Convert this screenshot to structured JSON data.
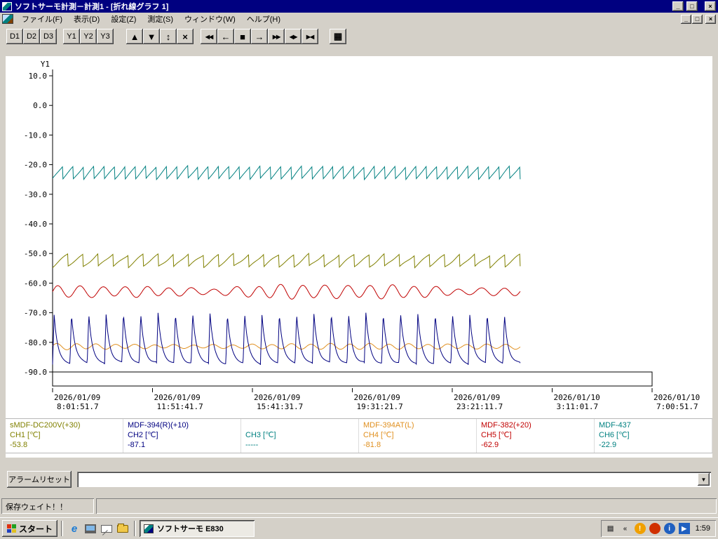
{
  "window": {
    "title": "ソフトサーモ計測－計測1 - [折れ線グラフ 1]",
    "controls": {
      "minimize": "_",
      "maximize": "□",
      "close": "×"
    }
  },
  "mdi": {
    "controls": {
      "minimize": "_",
      "restore": "□",
      "close": "×"
    }
  },
  "menu": {
    "items": [
      {
        "key": "file",
        "label": "ファイル(F)"
      },
      {
        "key": "view",
        "label": "表示(D)"
      },
      {
        "key": "settings",
        "label": "設定(Z)"
      },
      {
        "key": "measure",
        "label": "測定(S)"
      },
      {
        "key": "window",
        "label": "ウィンドウ(W)"
      },
      {
        "key": "help",
        "label": "ヘルプ(H)"
      }
    ]
  },
  "toolbar": {
    "groups": [
      {
        "name": "data-group",
        "buttons": [
          {
            "name": "d1-button",
            "label": "D1",
            "kind": "text"
          },
          {
            "name": "d2-button",
            "label": "D2",
            "kind": "text"
          },
          {
            "name": "d3-button",
            "label": "D3",
            "kind": "text"
          }
        ]
      },
      {
        "name": "y-axis-group",
        "buttons": [
          {
            "name": "y1-button",
            "label": "Y1",
            "kind": "text"
          },
          {
            "name": "y2-button",
            "label": "Y2",
            "kind": "text"
          },
          {
            "name": "y3-button",
            "label": "Y3",
            "kind": "text"
          }
        ]
      },
      {
        "name": "scale-group",
        "buttons": [
          {
            "name": "scroll-up-button",
            "label": "▲",
            "kind": "glyph"
          },
          {
            "name": "scroll-down-button",
            "label": "▼",
            "kind": "glyph"
          },
          {
            "name": "expand-vertical-button",
            "label": "↕",
            "kind": "glyph"
          },
          {
            "name": "auto-scale-button",
            "label": "×",
            "kind": "glyph"
          }
        ]
      },
      {
        "name": "time-scroll-group",
        "buttons": [
          {
            "name": "fast-rewind-button",
            "label": "◀◀",
            "kind": "tiny"
          },
          {
            "name": "step-left-button",
            "label": "←",
            "kind": "glyph"
          },
          {
            "name": "stop-button",
            "label": "■",
            "kind": "glyph"
          },
          {
            "name": "step-right-button",
            "label": "→",
            "kind": "glyph"
          },
          {
            "name": "fast-forward-button",
            "label": "▶▶",
            "kind": "tiny"
          },
          {
            "name": "expand-time-button",
            "label": "◀▶",
            "kind": "tiny"
          },
          {
            "name": "shrink-time-button",
            "label": "▶◀",
            "kind": "tiny"
          }
        ]
      },
      {
        "name": "view-group",
        "buttons": [
          {
            "name": "graph-list-button",
            "label": "▦",
            "kind": "glyph"
          }
        ]
      }
    ]
  },
  "chart_data": {
    "type": "line",
    "title": "折れ線グラフ 1",
    "y_axis_label": "Y1",
    "y_unit": "℃",
    "ylim": [
      -90,
      10
    ],
    "y_ticks": [
      "10.0",
      "0.0",
      "-10.0",
      "-20.0",
      "-30.0",
      "-40.0",
      "-50.0",
      "-60.0",
      "-70.0",
      "-80.0",
      "-90.0"
    ],
    "x_ticks": [
      {
        "date": "2026/01/09",
        "time": "8:01:51.7"
      },
      {
        "date": "2026/01/09",
        "time": "11:51:41.7"
      },
      {
        "date": "2026/01/09",
        "time": "15:41:31.7"
      },
      {
        "date": "2026/01/09",
        "time": "19:31:21.7"
      },
      {
        "date": "2026/01/09",
        "time": "23:21:11.7"
      },
      {
        "date": "2026/01/10",
        "time": "3:11:01.7"
      },
      {
        "date": "2026/01/10",
        "time": "7:00:51.7"
      }
    ],
    "data_end_fraction": 0.78,
    "series": [
      {
        "name": "CH6",
        "label": "MDF-437",
        "color": "#008080",
        "wave": "saw",
        "min": -24.8,
        "max": -20.5,
        "cycles": 45,
        "noise": 0.25,
        "seed": 1,
        "current": -22.9
      },
      {
        "name": "CH1",
        "label": "sMDF-DC200V(+30)",
        "color": "#808000",
        "wave": "saw",
        "min": -54.5,
        "max": -50.3,
        "cycles": 31,
        "noise": 0.4,
        "seed": 2,
        "current": -53.8
      },
      {
        "name": "CH5",
        "label": "MDF-382(+20)",
        "color": "#c00000",
        "wave": "sine",
        "mid": -62.9,
        "amp": 1.8,
        "cycles": 21,
        "am": 0.3,
        "noise": 0.5,
        "seed": 3,
        "current": -62.9
      },
      {
        "name": "CH4",
        "label": "MDF-394AT(L)",
        "color": "#e09020",
        "wave": "sine",
        "mid": -81.4,
        "amp": 0.85,
        "cycles": 24,
        "am": 0.2,
        "noise": 0.25,
        "seed": 5,
        "current": -81.8
      },
      {
        "name": "CH2",
        "label": "MDF-394(R)(+10)",
        "color": "#000080",
        "wave": "spike",
        "min": -87.2,
        "max": -70.4,
        "cycles": 27,
        "rise": 0.09,
        "decay": 4.5,
        "noise": 0.4,
        "seed": 4,
        "current": -87.1
      }
    ]
  },
  "legend": {
    "channels": [
      {
        "name": "sMDF-DC200V(+30)",
        "channel": "CH1 [℃]",
        "value": "-53.8",
        "color": "#808000"
      },
      {
        "name": "MDF-394(R)(+10)",
        "channel": "CH2 [℃]",
        "value": "-87.1",
        "color": "#000080"
      },
      {
        "name": "",
        "channel": "CH3 [℃]",
        "value": "-----",
        "color": "#008080"
      },
      {
        "name": "MDF-394AT(L)",
        "channel": "CH4 [℃]",
        "value": "-81.8",
        "color": "#e09020"
      },
      {
        "name": "MDF-382(+20)",
        "channel": "CH5 [℃]",
        "value": "-62.9",
        "color": "#c00000"
      },
      {
        "name": "MDF-437",
        "channel": "CH6 [℃]",
        "value": "-22.9",
        "color": "#008080"
      }
    ]
  },
  "alarm": {
    "reset_label": "アラームリセット",
    "combo_value": ""
  },
  "statusbar": {
    "text": "保存ウェイト！！"
  },
  "taskbar": {
    "start_label": "スタート",
    "quick_launch": [
      {
        "name": "ie-icon",
        "glyph": "e"
      },
      {
        "name": "show-desktop-icon"
      },
      {
        "name": "mail-icon"
      },
      {
        "name": "folder-icon"
      }
    ],
    "task_button": {
      "label": "ソフトサーモ  E830"
    },
    "tray": {
      "icons": [
        {
          "name": "ime-icon",
          "glyph": "▤",
          "shape": "plain"
        },
        {
          "name": "collapse-chevron-icon",
          "glyph": "«",
          "shape": "plain"
        },
        {
          "name": "alert-icon",
          "glyph": "!",
          "shape": "circle",
          "bg": "#f0a000"
        },
        {
          "name": "status-red-icon",
          "glyph": "",
          "shape": "circle",
          "bg": "#d03000"
        },
        {
          "name": "info-icon",
          "glyph": "i",
          "shape": "circle",
          "bg": "#2060c0"
        },
        {
          "name": "play-icon",
          "glyph": "▶",
          "shape": "square",
          "bg": "#2060c0"
        }
      ],
      "clock": "1:59"
    }
  }
}
